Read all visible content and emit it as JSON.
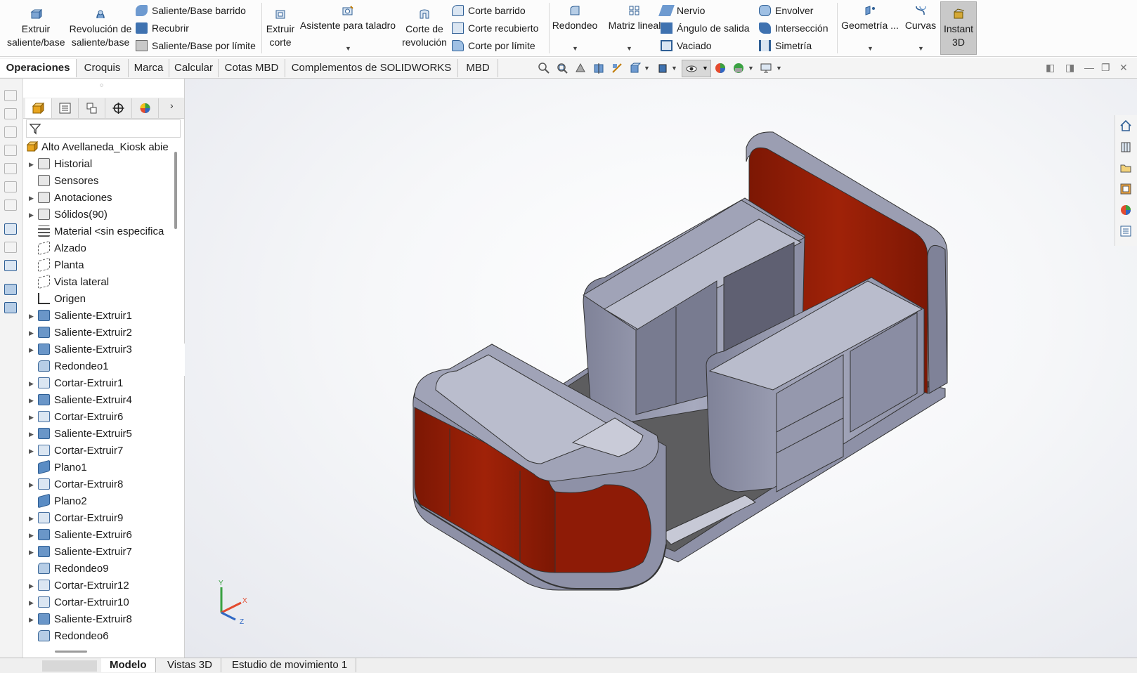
{
  "ribbon": {
    "big_buttons": [
      {
        "id": "extruir-saliente-base",
        "line1": "Extruir",
        "line2": "saliente/base",
        "icon": "extrude-boss-icon"
      },
      {
        "id": "revolucion-saliente-base",
        "line1": "Revolución de",
        "line2": "saliente/base",
        "icon": "revolve-boss-icon"
      },
      {
        "id": "extruir-corte",
        "line1": "Extruir",
        "line2": "corte",
        "icon": "extrude-cut-icon"
      },
      {
        "id": "asistente-taladro",
        "line1": "Asistente para taladro",
        "line2": "",
        "icon": "hole-wizard-icon"
      },
      {
        "id": "corte-revolucion",
        "line1": "Corte de",
        "line2": "revolución",
        "icon": "revolve-cut-icon"
      },
      {
        "id": "redondeo",
        "line1": "Redondeo",
        "line2": "",
        "icon": "fillet-icon"
      },
      {
        "id": "matriz-lineal",
        "line1": "Matriz lineal",
        "line2": "",
        "icon": "linear-pattern-icon"
      },
      {
        "id": "geometria",
        "line1": "Geometría ...",
        "line2": "",
        "icon": "reference-geometry-icon"
      },
      {
        "id": "curvas",
        "line1": "Curvas",
        "line2": "",
        "icon": "curves-icon"
      },
      {
        "id": "instant-3d",
        "line1": "Instant",
        "line2": "3D",
        "icon": "instant-3d-icon"
      }
    ],
    "small_group1": [
      "Saliente/Base barrido",
      "Recubrir",
      "Saliente/Base por límite"
    ],
    "small_group2": [
      "Corte barrido",
      "Corte recubierto",
      "Corte por límite"
    ],
    "small_group3": [
      "Nervio",
      "Ángulo de salida",
      "Vaciado"
    ],
    "small_group4": [
      "Envolver",
      "Intersección",
      "Simetría"
    ]
  },
  "tabs": [
    "Operaciones",
    "Croquis",
    "Marca",
    "Calcular",
    "Cotas MBD",
    "Complementos de SOLIDWORKS",
    "MBD"
  ],
  "tree": {
    "root": "Alto Avellaneda_Kiosk abie",
    "items": [
      {
        "label": "Historial",
        "icon": "folder",
        "expand": true
      },
      {
        "label": "Sensores",
        "icon": "folder",
        "expand": false
      },
      {
        "label": "Anotaciones",
        "icon": "folder",
        "expand": true
      },
      {
        "label": "Sólidos(90)",
        "icon": "folder",
        "expand": true
      },
      {
        "label": "Material <sin especifica",
        "icon": "material",
        "expand": false
      },
      {
        "label": "Alzado",
        "icon": "refp",
        "expand": false
      },
      {
        "label": "Planta",
        "icon": "refp",
        "expand": false
      },
      {
        "label": "Vista lateral",
        "icon": "refp",
        "expand": false
      },
      {
        "label": "Origen",
        "icon": "origin",
        "expand": false
      },
      {
        "label": "Saliente-Extruir1",
        "icon": "feat",
        "expand": true
      },
      {
        "label": "Saliente-Extruir2",
        "icon": "feat",
        "expand": true
      },
      {
        "label": "Saliente-Extruir3",
        "icon": "feat",
        "expand": true
      },
      {
        "label": "Redondeo1",
        "icon": "fil",
        "expand": false
      },
      {
        "label": "Cortar-Extruir1",
        "icon": "cut",
        "expand": true
      },
      {
        "label": "Saliente-Extruir4",
        "icon": "feat",
        "expand": true
      },
      {
        "label": "Cortar-Extruir6",
        "icon": "cut",
        "expand": true
      },
      {
        "label": "Saliente-Extruir5",
        "icon": "feat",
        "expand": true
      },
      {
        "label": "Cortar-Extruir7",
        "icon": "cut",
        "expand": true
      },
      {
        "label": "Plano1",
        "icon": "plane",
        "expand": false
      },
      {
        "label": "Cortar-Extruir8",
        "icon": "cut",
        "expand": true
      },
      {
        "label": "Plano2",
        "icon": "plane",
        "expand": false
      },
      {
        "label": "Cortar-Extruir9",
        "icon": "cut",
        "expand": true
      },
      {
        "label": "Saliente-Extruir6",
        "icon": "feat",
        "expand": true
      },
      {
        "label": "Saliente-Extruir7",
        "icon": "feat",
        "expand": true
      },
      {
        "label": "Redondeo9",
        "icon": "fil",
        "expand": false
      },
      {
        "label": "Cortar-Extruir12",
        "icon": "cut",
        "expand": true
      },
      {
        "label": "Cortar-Extruir10",
        "icon": "cut",
        "expand": true
      },
      {
        "label": "Saliente-Extruir8",
        "icon": "feat",
        "expand": true
      },
      {
        "label": "Redondeo6",
        "icon": "fil",
        "expand": false
      }
    ]
  },
  "bottom_tabs": [
    "Modelo",
    "Vistas 3D",
    "Estudio de movimiento 1"
  ],
  "triad": {
    "x": "X",
    "y": "Y",
    "z": "Z"
  },
  "colors": {
    "body": "#8c8fa8",
    "red_panel": "#8e1b06",
    "floor": "#5d5d5f"
  }
}
